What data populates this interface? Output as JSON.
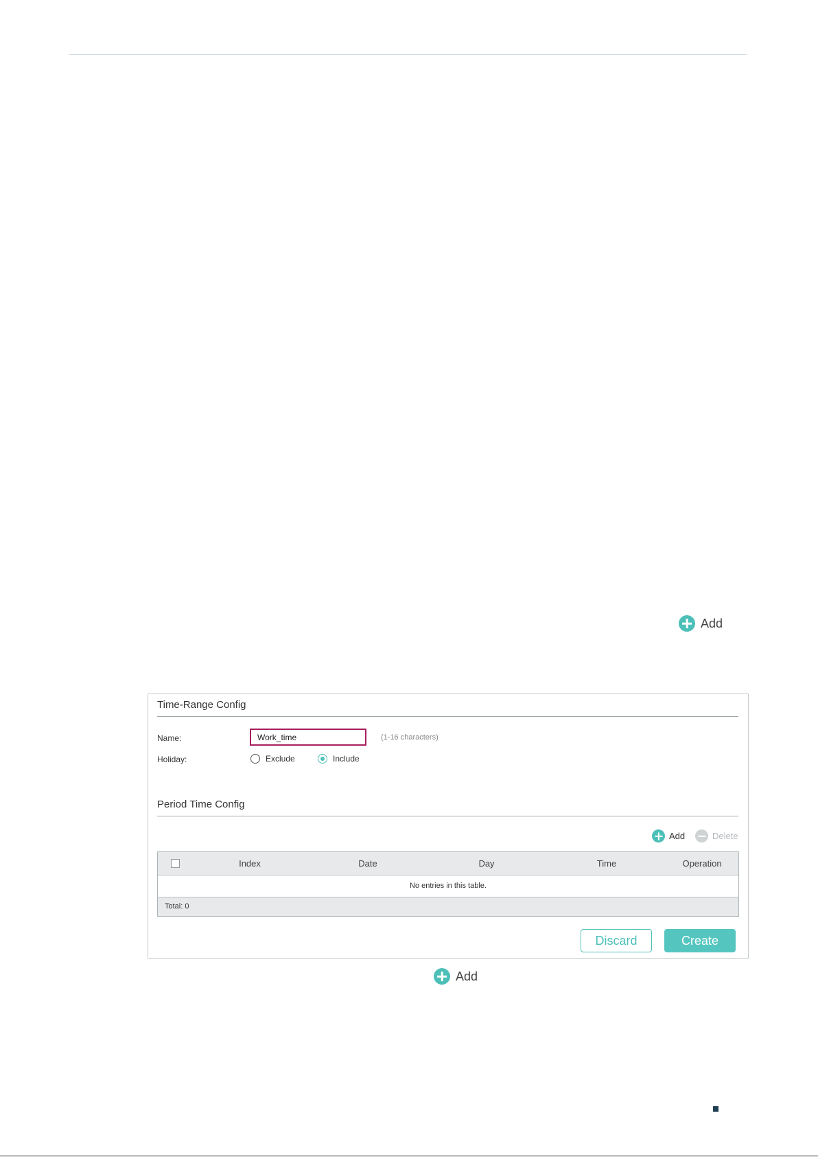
{
  "floating_add_top": {
    "label": "Add",
    "icon": "plus-circle-icon"
  },
  "floating_add_bottom": {
    "label": "Add",
    "icon": "plus-circle-icon"
  },
  "time_range_config": {
    "title": "Time-Range Config",
    "name_label": "Name:",
    "name_value": "Work_time",
    "name_hint": "(1-16 characters)",
    "holiday_label": "Holiday:",
    "holiday_options": [
      {
        "label": "Exclude",
        "selected": false
      },
      {
        "label": "Include",
        "selected": true
      }
    ]
  },
  "period_time_config": {
    "title": "Period Time Config",
    "toolbar": {
      "add_label": "Add",
      "delete_label": "Delete"
    },
    "table": {
      "columns": [
        "Index",
        "Date",
        "Day",
        "Time",
        "Operation"
      ],
      "empty_text": "No entries in this table.",
      "footer": "Total: 0"
    }
  },
  "buttons": {
    "discard": "Discard",
    "create": "Create"
  },
  "colors": {
    "accent": "#4cc0b8",
    "highlight_border": "#a71e5d",
    "disabled": "#cfd3d4"
  }
}
